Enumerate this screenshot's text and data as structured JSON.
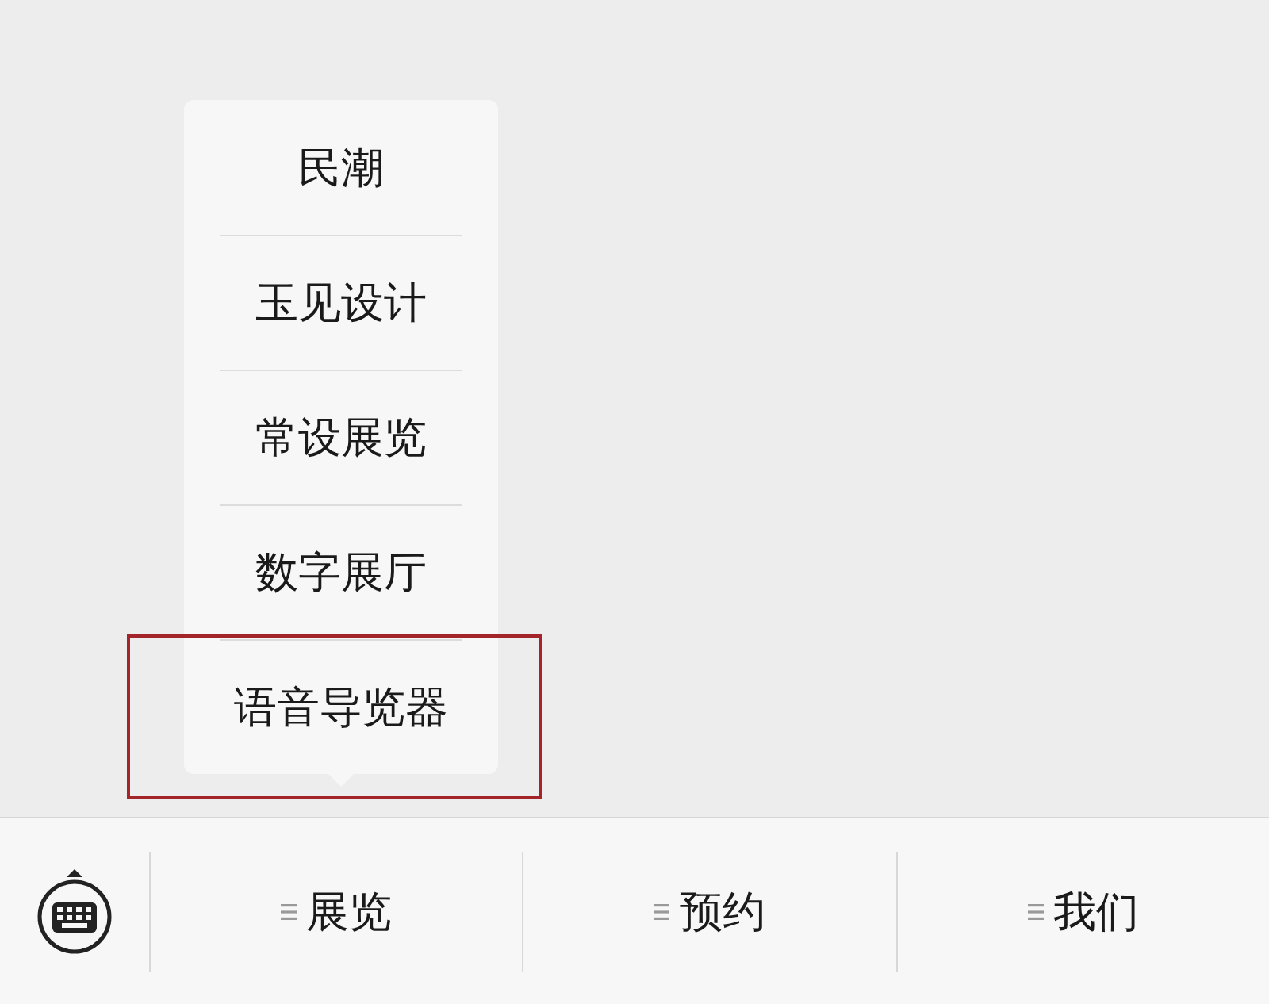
{
  "popup_menu": {
    "items": [
      {
        "label": "民潮",
        "highlighted": false
      },
      {
        "label": "玉见设计",
        "highlighted": false
      },
      {
        "label": "常设展览",
        "highlighted": false
      },
      {
        "label": "数字展厅",
        "highlighted": false
      },
      {
        "label": "语音导览器",
        "highlighted": true
      }
    ]
  },
  "bottom_bar": {
    "menus": [
      {
        "label": "展览"
      },
      {
        "label": "预约"
      },
      {
        "label": "我们"
      }
    ]
  }
}
